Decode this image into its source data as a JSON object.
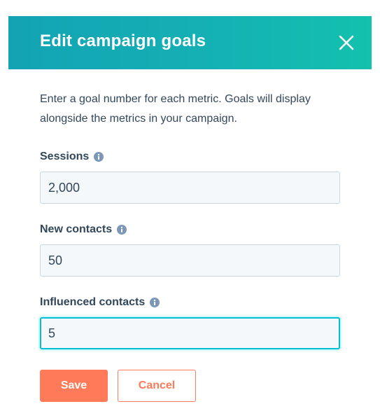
{
  "dialog": {
    "title": "Edit campaign goals",
    "close_icon": "close-icon",
    "description": "Enter a goal number for each metric. Goals will display alongside the metrics in your campaign."
  },
  "fields": [
    {
      "label": "Sessions",
      "value": "2,000",
      "info_icon": "info-icon"
    },
    {
      "label": "New contacts",
      "value": "50",
      "info_icon": "info-icon"
    },
    {
      "label": "Influenced contacts",
      "value": "5",
      "info_icon": "info-icon",
      "focused": true
    }
  ],
  "actions": {
    "save_label": "Save",
    "cancel_label": "Cancel"
  },
  "colors": {
    "header_gradient_start": "#13a3b4",
    "header_gradient_end": "#13c1ad",
    "primary_button": "#ff7a59",
    "text": "#33475b",
    "info_icon": "#7c98b6",
    "focus_border": "#00bfd5"
  }
}
